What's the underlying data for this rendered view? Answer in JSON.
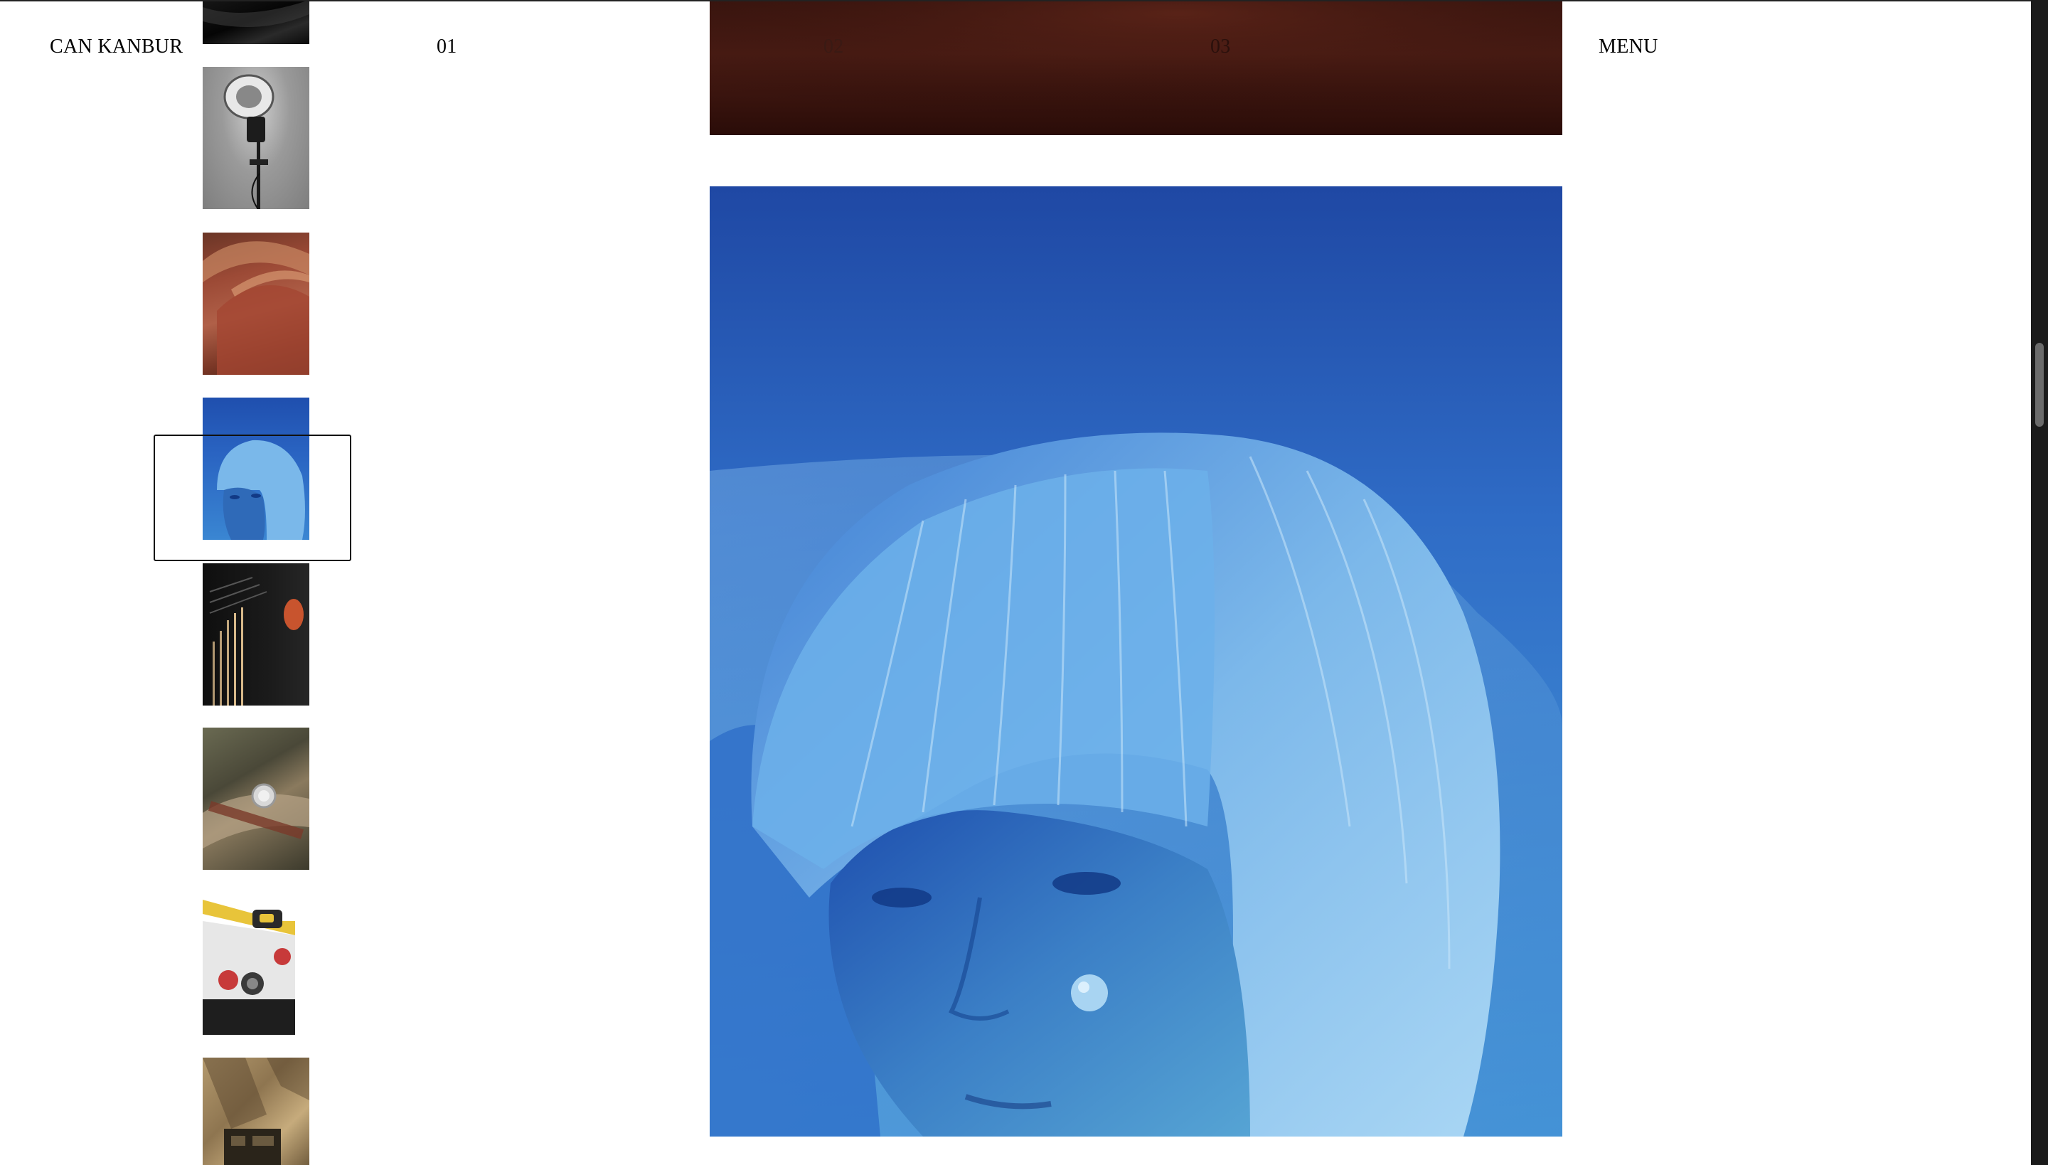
{
  "header": {
    "brand": "CAN KANBUR",
    "nav": [
      "01",
      "02",
      "03"
    ],
    "menu_label": "MENU"
  },
  "gallery": {
    "thumbnails": [
      {
        "name": "thumb-dark-abstract",
        "subject": "dark abstract"
      },
      {
        "name": "thumb-studio-light",
        "subject": "studio light on stand"
      },
      {
        "name": "thumb-red-curves",
        "subject": "red curved shapes"
      },
      {
        "name": "thumb-blue-portrait",
        "subject": "blue-haired portrait",
        "selected": true
      },
      {
        "name": "thumb-black-device",
        "subject": "black device with light strips"
      },
      {
        "name": "thumb-watch",
        "subject": "watch on rock"
      },
      {
        "name": "thumb-yellow-camera",
        "subject": "white and yellow camera"
      },
      {
        "name": "thumb-shadow-scene",
        "subject": "shadowed still life"
      }
    ]
  },
  "colors": {
    "background": "#ffffff",
    "text": "#000000",
    "hero_blue": "#2d69c4",
    "top_image_red": "#3a150f",
    "scrollbar_track": "#1b1b1b",
    "scrollbar_thumb": "#6b6b6b"
  }
}
